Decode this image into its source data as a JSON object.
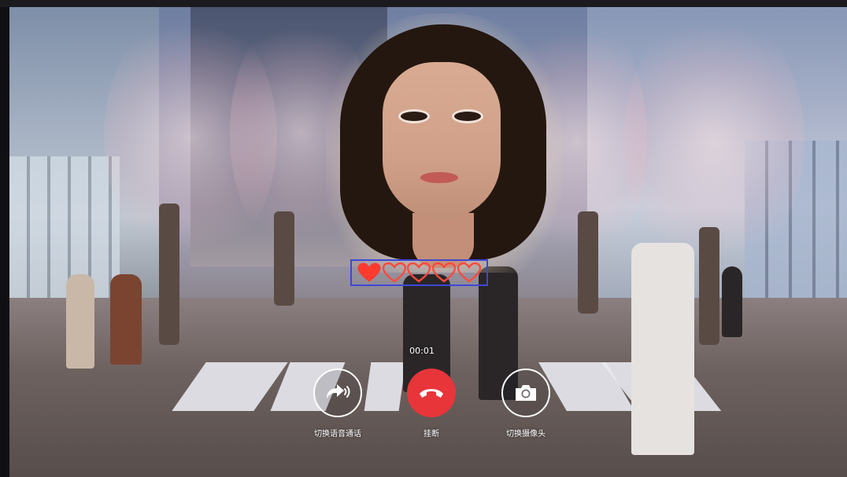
{
  "call": {
    "timer": "00:01",
    "controls": [
      {
        "id": "switch-voice",
        "label": "切换语音通话",
        "icon": "voice-forward-icon"
      },
      {
        "id": "hangup",
        "label": "挂断",
        "icon": "phone-hangup-icon"
      },
      {
        "id": "switch-camera",
        "label": "切换摄像头",
        "icon": "camera-icon"
      }
    ]
  },
  "rating": {
    "icon": "heart-icon",
    "total": 5,
    "filled": 1,
    "filled_color": "#ff3b30",
    "outline_color": "#ff4a3d",
    "frame_color": "#3f47d8"
  },
  "colors": {
    "hangup_red": "#e8353a",
    "control_outline": "#ffffff"
  }
}
